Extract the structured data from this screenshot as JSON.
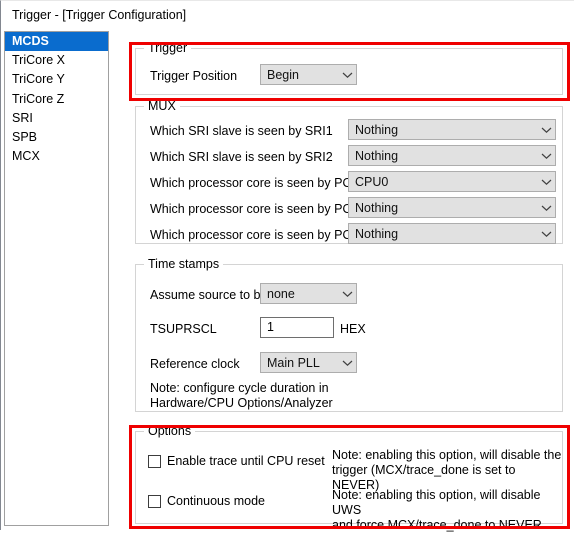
{
  "window": {
    "title": "Trigger - [Trigger Configuration]"
  },
  "sidebar": {
    "items": [
      {
        "label": "MCDS",
        "selected": true
      },
      {
        "label": "TriCore X",
        "selected": false
      },
      {
        "label": "TriCore Y",
        "selected": false
      },
      {
        "label": "TriCore Z",
        "selected": false
      },
      {
        "label": "SRI",
        "selected": false
      },
      {
        "label": "SPB",
        "selected": false
      },
      {
        "label": "MCX",
        "selected": false
      }
    ]
  },
  "trigger_group": {
    "title": "Trigger",
    "position_label": "Trigger Position",
    "position_value": "Begin",
    "dropdown_icon": "chevron-down-icon"
  },
  "mux_group": {
    "title": "MUX",
    "rows": [
      {
        "label": "Which SRI slave is seen by SRI1",
        "value": "Nothing"
      },
      {
        "label": "Which SRI slave is seen by SRI2",
        "value": "Nothing"
      },
      {
        "label": "Which processor core is seen by POB X",
        "value": "CPU0"
      },
      {
        "label": "Which processor core is seen by POB Y",
        "value": "Nothing"
      },
      {
        "label": "Which processor core is seen by POB Z",
        "value": "Nothing"
      }
    ]
  },
  "timestamps_group": {
    "title": "Time stamps",
    "source_label": "Assume source to be",
    "source_value": "none",
    "tsuprscl_label": "TSUPRSCL",
    "tsuprscl_value": "1",
    "tsuprscl_unit": "HEX",
    "refclock_label": "Reference clock",
    "refclock_value": "Main PLL",
    "note": "Note: configure cycle duration in\nHardware/CPU Options/Analyzer"
  },
  "options_group": {
    "title": "Options",
    "rows": [
      {
        "label": "Enable trace until CPU reset",
        "checked": false,
        "note": "Note: enabling this option, will disable the\ntrigger (MCX/trace_done is set to NEVER)"
      },
      {
        "label": "Continuous mode",
        "checked": false,
        "note": "Note: enabling this option, will disable UWS\nand force MCX/trace_done to NEVER"
      }
    ]
  },
  "highlights": {
    "color": "#ef0000",
    "regions": [
      "trigger-group",
      "options-group"
    ]
  }
}
